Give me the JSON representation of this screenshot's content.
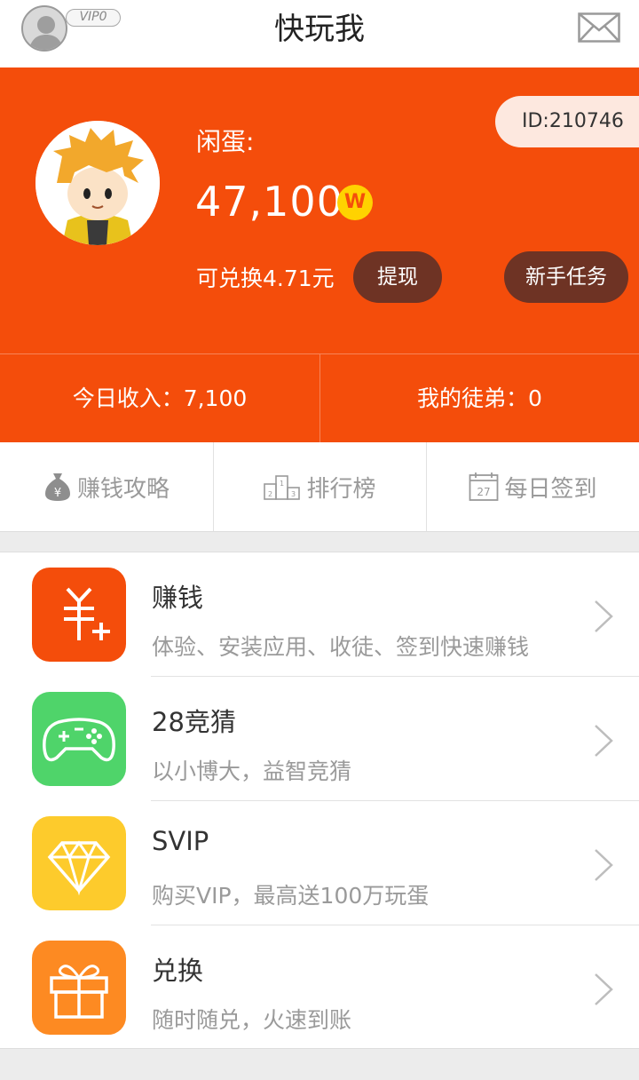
{
  "header": {
    "title": "快玩我",
    "vip_badge": "VIP0",
    "icons": {
      "avatar": "user-silhouette-icon",
      "mail": "envelope-icon"
    }
  },
  "profile": {
    "id_label": "ID:210746",
    "nickname": "闲蛋:",
    "balance": "47,100",
    "coin_symbol": "W",
    "exchange_text": "可兑换4.71元",
    "withdraw_label": "提现",
    "task_label": "新手任务",
    "colors": {
      "background": "#f44d0b",
      "button": "#6e3324",
      "coin": "#ffd200"
    }
  },
  "stats": {
    "today_income": "今日收入：7,100",
    "disciples": "我的徒弟：0"
  },
  "quick_links": [
    {
      "label": "赚钱攻略",
      "icon": "money-bag-icon"
    },
    {
      "label": "排行榜",
      "icon": "podium-icon"
    },
    {
      "label": "每日签到",
      "icon": "calendar-icon",
      "icon_text": "27"
    }
  ],
  "menu": [
    {
      "title": "赚钱",
      "desc": "体验、安装应用、收徒、签到快速赚钱",
      "icon": "yuan-plus-icon",
      "color": "#f44d0b"
    },
    {
      "title": "28竞猜",
      "desc": "以小博大，益智竞猜",
      "icon": "gamepad-icon",
      "color": "#4fd46a"
    },
    {
      "title": "SVIP",
      "desc": "购买VIP，最高送100万玩蛋",
      "icon": "diamond-icon",
      "color": "#fdcb2c"
    },
    {
      "title": "兑换",
      "desc": "随时随兑，火速到账",
      "icon": "gift-icon",
      "color": "#fd8a22"
    }
  ]
}
